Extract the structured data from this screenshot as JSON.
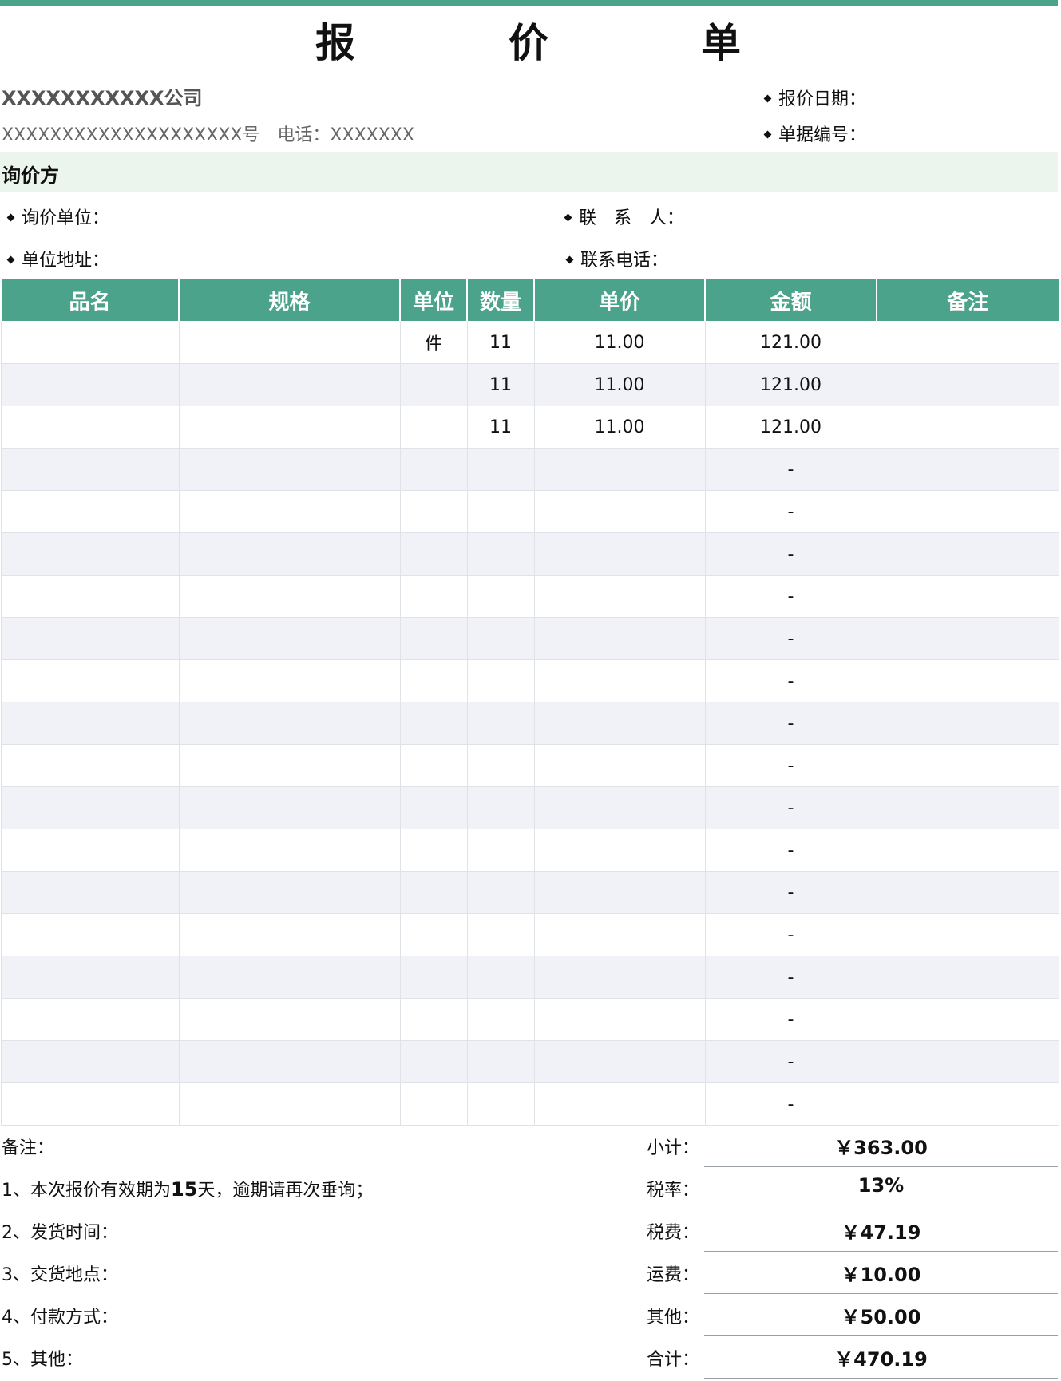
{
  "title": {
    "char1": "报",
    "char2": "价",
    "char3": "单"
  },
  "header": {
    "company": "XXXXXXXXXXX公司",
    "address": "XXXXXXXXXXXXXXXXXXXX号　电话：XXXXXXX",
    "quote_date_label": "报价日期：",
    "doc_no_label": "单据编号："
  },
  "inquiry": {
    "section_title": "询价方",
    "unit_label": "询价单位：",
    "contact_label": "联　系　人：",
    "address_label": "单位地址：",
    "phone_label": "联系电话："
  },
  "table": {
    "headers": [
      "品名",
      "规格",
      "单位",
      "数量",
      "单价",
      "金额",
      "备注"
    ],
    "rows": [
      [
        "",
        "",
        "件",
        "11",
        "11.00",
        "121.00",
        ""
      ],
      [
        "",
        "",
        "",
        "11",
        "11.00",
        "121.00",
        ""
      ],
      [
        "",
        "",
        "",
        "11",
        "11.00",
        "121.00",
        ""
      ],
      [
        "",
        "",
        "",
        "",
        "",
        "-",
        ""
      ],
      [
        "",
        "",
        "",
        "",
        "",
        "-",
        ""
      ],
      [
        "",
        "",
        "",
        "",
        "",
        "-",
        ""
      ],
      [
        "",
        "",
        "",
        "",
        "",
        "-",
        ""
      ],
      [
        "",
        "",
        "",
        "",
        "",
        "-",
        ""
      ],
      [
        "",
        "",
        "",
        "",
        "",
        "-",
        ""
      ],
      [
        "",
        "",
        "",
        "",
        "",
        "-",
        ""
      ],
      [
        "",
        "",
        "",
        "",
        "",
        "-",
        ""
      ],
      [
        "",
        "",
        "",
        "",
        "",
        "-",
        ""
      ],
      [
        "",
        "",
        "",
        "",
        "",
        "-",
        ""
      ],
      [
        "",
        "",
        "",
        "",
        "",
        "-",
        ""
      ],
      [
        "",
        "",
        "",
        "",
        "",
        "-",
        ""
      ],
      [
        "",
        "",
        "",
        "",
        "",
        "-",
        ""
      ],
      [
        "",
        "",
        "",
        "",
        "",
        "-",
        ""
      ],
      [
        "",
        "",
        "",
        "",
        "",
        "-",
        ""
      ],
      [
        "",
        "",
        "",
        "",
        "",
        "-",
        ""
      ]
    ]
  },
  "notes": {
    "label": "备注：",
    "item1_prefix": "1、本次报价有效期为",
    "item1_days": "15",
    "item1_suffix": "天，逾期请再次垂询；",
    "item2": "2、发货时间：",
    "item3": "3、交货地点：",
    "item4": "4、付款方式：",
    "item5": "5、其他："
  },
  "summary": {
    "subtotal_label": "小计：",
    "subtotal_value": "￥363.00",
    "tax_rate_label": "税率：",
    "tax_rate_value": "13%",
    "tax_label": "税费：",
    "tax_value": "￥47.19",
    "shipping_label": "运费：",
    "shipping_value": "￥10.00",
    "other_label": "其他：",
    "other_value": "￥50.00",
    "total_label": "合计：",
    "total_value": "￥470.19"
  },
  "colors": {
    "accent": "#4aa38a",
    "band": "#ebf5ee",
    "alt_row": "#f0f2f7"
  }
}
